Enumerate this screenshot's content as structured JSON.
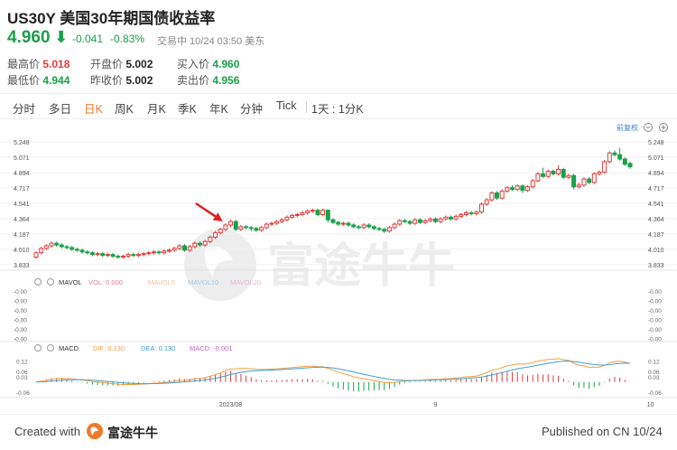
{
  "header": {
    "symbol": "US30Y",
    "name": "美国30年期国债收益率",
    "price": "4.960",
    "change": "-0.041",
    "change_pct": "-0.83%",
    "status": "交易中 10/24 03:50 美东"
  },
  "quote": {
    "high_label": "最高价",
    "high": "5.018",
    "open_label": "开盘价",
    "open": "5.002",
    "bid_label": "买入价",
    "bid": "4.960",
    "low_label": "最低价",
    "low": "4.944",
    "prev_close_label": "昨收价",
    "prev_close": "5.002",
    "ask_label": "卖出价",
    "ask": "4.956"
  },
  "tabs": [
    "分时",
    "多日",
    "日K",
    "周K",
    "月K",
    "季K",
    "年K",
    "分钟",
    "Tick",
    "1天 : 1分K"
  ],
  "active_tab": "日K",
  "adjust_label": "前复权",
  "volume_legend": {
    "name": "MAVOL",
    "vol": "VOL: 0.000",
    "ma5": "MAVOL5",
    "ma10": "MAVOL10",
    "ma20": "MAVOL20"
  },
  "macd_legend": {
    "name": "MACD",
    "dif": "DIF: 0.130",
    "dea": "DEA: 0.130",
    "macd": "MACD: -0.001"
  },
  "watermark": "富途牛牛",
  "footer": {
    "created": "Created with",
    "brand": "富途牛牛",
    "published": "Published on CN 10/24"
  },
  "colors": {
    "up": "#e03c3c",
    "down": "#1aa04a",
    "accent": "#f07a2a",
    "dif": "#f0a040",
    "dea": "#3fa0d0"
  },
  "chart_data": [
    {
      "type": "candlestick",
      "title": "",
      "y_ticks": [
        5.248,
        5.071,
        4.894,
        4.717,
        4.541,
        4.364,
        4.187,
        4.01,
        3.833
      ],
      "ylim": [
        3.78,
        5.3
      ],
      "x_tick_labels": [
        {
          "index": 38,
          "label": "2023/08"
        },
        {
          "index": 78,
          "label": "9"
        },
        {
          "index": 120,
          "label": "10"
        }
      ],
      "annotation": {
        "type": "arrow",
        "target_index": 37
      },
      "candles": [
        {
          "o": 3.92,
          "c": 3.97,
          "h": 3.99,
          "l": 3.9
        },
        {
          "o": 3.97,
          "c": 4.02,
          "h": 4.04,
          "l": 3.95
        },
        {
          "o": 4.02,
          "c": 4.05,
          "h": 4.07,
          "l": 4.0
        },
        {
          "o": 4.05,
          "c": 4.08,
          "h": 4.1,
          "l": 4.03
        },
        {
          "o": 4.08,
          "c": 4.06,
          "h": 4.1,
          "l": 4.04
        },
        {
          "o": 4.06,
          "c": 4.04,
          "h": 4.08,
          "l": 4.02
        },
        {
          "o": 4.04,
          "c": 4.03,
          "h": 4.06,
          "l": 4.01
        },
        {
          "o": 4.03,
          "c": 4.01,
          "h": 4.05,
          "l": 3.99
        },
        {
          "o": 4.01,
          "c": 4.0,
          "h": 4.03,
          "l": 3.98
        },
        {
          "o": 4.0,
          "c": 3.98,
          "h": 4.02,
          "l": 3.96
        },
        {
          "o": 3.98,
          "c": 3.97,
          "h": 4.0,
          "l": 3.95
        },
        {
          "o": 3.97,
          "c": 3.95,
          "h": 3.99,
          "l": 3.93
        },
        {
          "o": 3.95,
          "c": 3.96,
          "h": 3.98,
          "l": 3.93
        },
        {
          "o": 3.96,
          "c": 3.94,
          "h": 3.98,
          "l": 3.92
        },
        {
          "o": 3.94,
          "c": 3.95,
          "h": 3.97,
          "l": 3.92
        },
        {
          "o": 3.95,
          "c": 3.93,
          "h": 3.97,
          "l": 3.91
        },
        {
          "o": 3.93,
          "c": 3.92,
          "h": 3.95,
          "l": 3.9
        },
        {
          "o": 3.92,
          "c": 3.93,
          "h": 3.95,
          "l": 3.9
        },
        {
          "o": 3.93,
          "c": 3.95,
          "h": 3.97,
          "l": 3.91
        },
        {
          "o": 3.95,
          "c": 3.94,
          "h": 3.97,
          "l": 3.92
        },
        {
          "o": 3.94,
          "c": 3.95,
          "h": 3.97,
          "l": 3.92
        },
        {
          "o": 3.95,
          "c": 3.96,
          "h": 3.98,
          "l": 3.93
        },
        {
          "o": 3.96,
          "c": 3.97,
          "h": 3.99,
          "l": 3.94
        },
        {
          "o": 3.97,
          "c": 3.98,
          "h": 4.0,
          "l": 3.95
        },
        {
          "o": 3.98,
          "c": 3.97,
          "h": 4.0,
          "l": 3.95
        },
        {
          "o": 3.97,
          "c": 3.99,
          "h": 4.01,
          "l": 3.95
        },
        {
          "o": 3.99,
          "c": 4.0,
          "h": 4.02,
          "l": 3.97
        },
        {
          "o": 4.0,
          "c": 4.02,
          "h": 4.04,
          "l": 3.98
        },
        {
          "o": 4.02,
          "c": 4.05,
          "h": 4.07,
          "l": 4.0
        },
        {
          "o": 4.05,
          "c": 4.0,
          "h": 4.07,
          "l": 3.98
        },
        {
          "o": 4.0,
          "c": 4.04,
          "h": 4.06,
          "l": 3.98
        },
        {
          "o": 4.04,
          "c": 4.08,
          "h": 4.1,
          "l": 4.02
        },
        {
          "o": 4.08,
          "c": 4.06,
          "h": 4.1,
          "l": 4.04
        },
        {
          "o": 4.06,
          "c": 4.1,
          "h": 4.12,
          "l": 4.04
        },
        {
          "o": 4.1,
          "c": 4.15,
          "h": 4.17,
          "l": 4.08
        },
        {
          "o": 4.15,
          "c": 4.2,
          "h": 4.22,
          "l": 4.13
        },
        {
          "o": 4.2,
          "c": 4.24,
          "h": 4.26,
          "l": 4.18
        },
        {
          "o": 4.24,
          "c": 4.29,
          "h": 4.31,
          "l": 4.22
        },
        {
          "o": 4.29,
          "c": 4.33,
          "h": 4.35,
          "l": 4.26
        },
        {
          "o": 4.33,
          "c": 4.24,
          "h": 4.35,
          "l": 4.22
        },
        {
          "o": 4.24,
          "c": 4.27,
          "h": 4.29,
          "l": 4.22
        },
        {
          "o": 4.27,
          "c": 4.26,
          "h": 4.29,
          "l": 4.24
        },
        {
          "o": 4.26,
          "c": 4.25,
          "h": 4.28,
          "l": 4.22
        },
        {
          "o": 4.25,
          "c": 4.23,
          "h": 4.27,
          "l": 4.21
        },
        {
          "o": 4.23,
          "c": 4.26,
          "h": 4.28,
          "l": 4.21
        },
        {
          "o": 4.26,
          "c": 4.3,
          "h": 4.32,
          "l": 4.24
        },
        {
          "o": 4.3,
          "c": 4.31,
          "h": 4.33,
          "l": 4.28
        },
        {
          "o": 4.31,
          "c": 4.33,
          "h": 4.35,
          "l": 4.29
        },
        {
          "o": 4.33,
          "c": 4.35,
          "h": 4.37,
          "l": 4.31
        },
        {
          "o": 4.35,
          "c": 4.38,
          "h": 4.4,
          "l": 4.33
        },
        {
          "o": 4.38,
          "c": 4.4,
          "h": 4.42,
          "l": 4.36
        },
        {
          "o": 4.4,
          "c": 4.41,
          "h": 4.43,
          "l": 4.38
        },
        {
          "o": 4.41,
          "c": 4.43,
          "h": 4.45,
          "l": 4.39
        },
        {
          "o": 4.43,
          "c": 4.45,
          "h": 4.47,
          "l": 4.41
        },
        {
          "o": 4.45,
          "c": 4.46,
          "h": 4.48,
          "l": 4.43
        },
        {
          "o": 4.46,
          "c": 4.41,
          "h": 4.48,
          "l": 4.39
        },
        {
          "o": 4.41,
          "c": 4.46,
          "h": 4.48,
          "l": 4.39
        },
        {
          "o": 4.46,
          "c": 4.35,
          "h": 4.47,
          "l": 4.32
        },
        {
          "o": 4.35,
          "c": 4.32,
          "h": 4.37,
          "l": 4.3
        },
        {
          "o": 4.32,
          "c": 4.3,
          "h": 4.34,
          "l": 4.28
        },
        {
          "o": 4.3,
          "c": 4.31,
          "h": 4.33,
          "l": 4.28
        },
        {
          "o": 4.31,
          "c": 4.29,
          "h": 4.33,
          "l": 4.27
        },
        {
          "o": 4.29,
          "c": 4.27,
          "h": 4.31,
          "l": 4.25
        },
        {
          "o": 4.27,
          "c": 4.26,
          "h": 4.29,
          "l": 4.24
        },
        {
          "o": 4.26,
          "c": 4.29,
          "h": 4.31,
          "l": 4.24
        },
        {
          "o": 4.29,
          "c": 4.27,
          "h": 4.31,
          "l": 4.25
        },
        {
          "o": 4.27,
          "c": 4.25,
          "h": 4.29,
          "l": 4.23
        },
        {
          "o": 4.25,
          "c": 4.24,
          "h": 4.27,
          "l": 4.22
        },
        {
          "o": 4.24,
          "c": 4.22,
          "h": 4.26,
          "l": 4.2
        },
        {
          "o": 4.22,
          "c": 4.26,
          "h": 4.28,
          "l": 4.2
        },
        {
          "o": 4.26,
          "c": 4.3,
          "h": 4.32,
          "l": 4.24
        },
        {
          "o": 4.3,
          "c": 4.34,
          "h": 4.36,
          "l": 4.28
        },
        {
          "o": 4.34,
          "c": 4.33,
          "h": 4.36,
          "l": 4.31
        },
        {
          "o": 4.33,
          "c": 4.31,
          "h": 4.35,
          "l": 4.29
        },
        {
          "o": 4.31,
          "c": 4.35,
          "h": 4.37,
          "l": 4.29
        },
        {
          "o": 4.35,
          "c": 4.32,
          "h": 4.37,
          "l": 4.3
        },
        {
          "o": 4.32,
          "c": 4.34,
          "h": 4.36,
          "l": 4.3
        },
        {
          "o": 4.34,
          "c": 4.36,
          "h": 4.38,
          "l": 4.32
        },
        {
          "o": 4.36,
          "c": 4.33,
          "h": 4.38,
          "l": 4.31
        },
        {
          "o": 4.33,
          "c": 4.36,
          "h": 4.38,
          "l": 4.31
        },
        {
          "o": 4.36,
          "c": 4.38,
          "h": 4.4,
          "l": 4.34
        },
        {
          "o": 4.38,
          "c": 4.36,
          "h": 4.4,
          "l": 4.34
        },
        {
          "o": 4.36,
          "c": 4.39,
          "h": 4.41,
          "l": 4.34
        },
        {
          "o": 4.39,
          "c": 4.41,
          "h": 4.43,
          "l": 4.37
        },
        {
          "o": 4.41,
          "c": 4.43,
          "h": 4.45,
          "l": 4.39
        },
        {
          "o": 4.43,
          "c": 4.42,
          "h": 4.45,
          "l": 4.4
        },
        {
          "o": 4.42,
          "c": 4.44,
          "h": 4.46,
          "l": 4.4
        },
        {
          "o": 4.44,
          "c": 4.53,
          "h": 4.55,
          "l": 4.42
        },
        {
          "o": 4.53,
          "c": 4.58,
          "h": 4.6,
          "l": 4.51
        },
        {
          "o": 4.58,
          "c": 4.66,
          "h": 4.68,
          "l": 4.56
        },
        {
          "o": 4.66,
          "c": 4.6,
          "h": 4.68,
          "l": 4.58
        },
        {
          "o": 4.6,
          "c": 4.68,
          "h": 4.7,
          "l": 4.58
        },
        {
          "o": 4.68,
          "c": 4.72,
          "h": 4.74,
          "l": 4.66
        },
        {
          "o": 4.72,
          "c": 4.7,
          "h": 4.75,
          "l": 4.68
        },
        {
          "o": 4.7,
          "c": 4.74,
          "h": 4.76,
          "l": 4.68
        },
        {
          "o": 4.74,
          "c": 4.69,
          "h": 4.76,
          "l": 4.66
        },
        {
          "o": 4.69,
          "c": 4.73,
          "h": 4.75,
          "l": 4.67
        },
        {
          "o": 4.73,
          "c": 4.8,
          "h": 4.82,
          "l": 4.71
        },
        {
          "o": 4.8,
          "c": 4.88,
          "h": 4.9,
          "l": 4.78
        },
        {
          "o": 4.88,
          "c": 4.85,
          "h": 4.95,
          "l": 4.83
        },
        {
          "o": 4.85,
          "c": 4.91,
          "h": 4.93,
          "l": 4.83
        },
        {
          "o": 4.91,
          "c": 4.88,
          "h": 4.93,
          "l": 4.86
        },
        {
          "o": 4.88,
          "c": 4.93,
          "h": 4.98,
          "l": 4.86
        },
        {
          "o": 4.93,
          "c": 4.84,
          "h": 4.95,
          "l": 4.82
        },
        {
          "o": 4.84,
          "c": 4.86,
          "h": 4.88,
          "l": 4.82
        },
        {
          "o": 4.86,
          "c": 4.73,
          "h": 4.88,
          "l": 4.7
        },
        {
          "o": 4.73,
          "c": 4.75,
          "h": 4.78,
          "l": 4.71
        },
        {
          "o": 4.75,
          "c": 4.82,
          "h": 4.84,
          "l": 4.73
        },
        {
          "o": 4.82,
          "c": 4.78,
          "h": 4.84,
          "l": 4.76
        },
        {
          "o": 4.78,
          "c": 4.88,
          "h": 4.9,
          "l": 4.76
        },
        {
          "o": 4.88,
          "c": 4.9,
          "h": 4.92,
          "l": 4.86
        },
        {
          "o": 4.9,
          "c": 5.02,
          "h": 5.04,
          "l": 4.88
        },
        {
          "o": 5.02,
          "c": 5.12,
          "h": 5.14,
          "l": 5.0
        },
        {
          "o": 5.12,
          "c": 5.1,
          "h": 5.15,
          "l": 5.08
        },
        {
          "o": 5.1,
          "c": 5.05,
          "h": 5.18,
          "l": 5.03
        },
        {
          "o": 5.05,
          "c": 4.99,
          "h": 5.07,
          "l": 4.97
        },
        {
          "o": 5.0,
          "c": 4.96,
          "h": 5.02,
          "l": 4.94
        }
      ]
    },
    {
      "type": "bar",
      "title": "MACD",
      "y_ticks": [
        0.12,
        0.06,
        0.03,
        -0.06
      ],
      "ylim": [
        -0.08,
        0.15
      ]
    }
  ]
}
